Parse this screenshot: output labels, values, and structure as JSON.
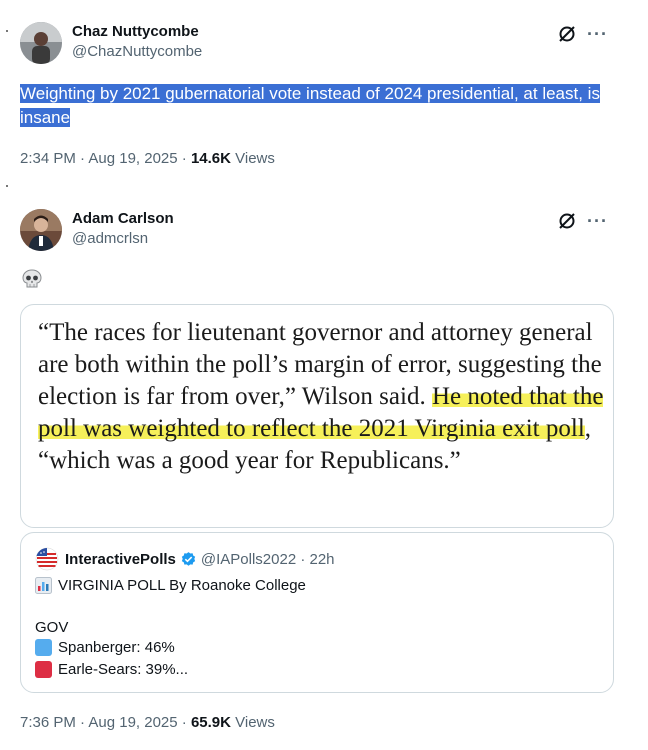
{
  "tweet1": {
    "display_name": "Chaz Nuttycombe",
    "handle": "@ChazNuttycombe",
    "text": "Weighting by 2021 gubernatorial vote instead of 2024 presidential, at least, is insane",
    "time": "2:34 PM · Aug 19, 2025 · ",
    "views_count": "14.6K",
    "views_label": " Views",
    "more_label": "···",
    "grok_icon": "grok-icon",
    "more_icon": "more-icon"
  },
  "tweet2": {
    "display_name": "Adam Carlson",
    "handle": "@admcrlsn",
    "emoji": "skull-icon",
    "image_text": {
      "part1": "“The races for lieutenant governor and attorney general are both within the poll’s margin of error, suggesting the election is far from over,” Wilson said. ",
      "highlight": "He noted that the poll was weighted to reflect the 2021 Virginia exit poll",
      "part2": ", “which was a good year for Republicans.”"
    },
    "quote": {
      "name": "InteractivePolls",
      "handle": "@IAPolls2022 · 22h",
      "line1": "VIRGINIA POLL By Roanoke College",
      "line2": "GOV",
      "line3": "Spanberger: 46%",
      "line4": "Earle-Sears: 39%...",
      "square1_color": "#55acee",
      "square2_color": "#dd2e44"
    },
    "time": "7:36 PM · Aug 19, 2025 · ",
    "views_count": "65.9K",
    "views_label": " Views",
    "more_label": "···"
  }
}
